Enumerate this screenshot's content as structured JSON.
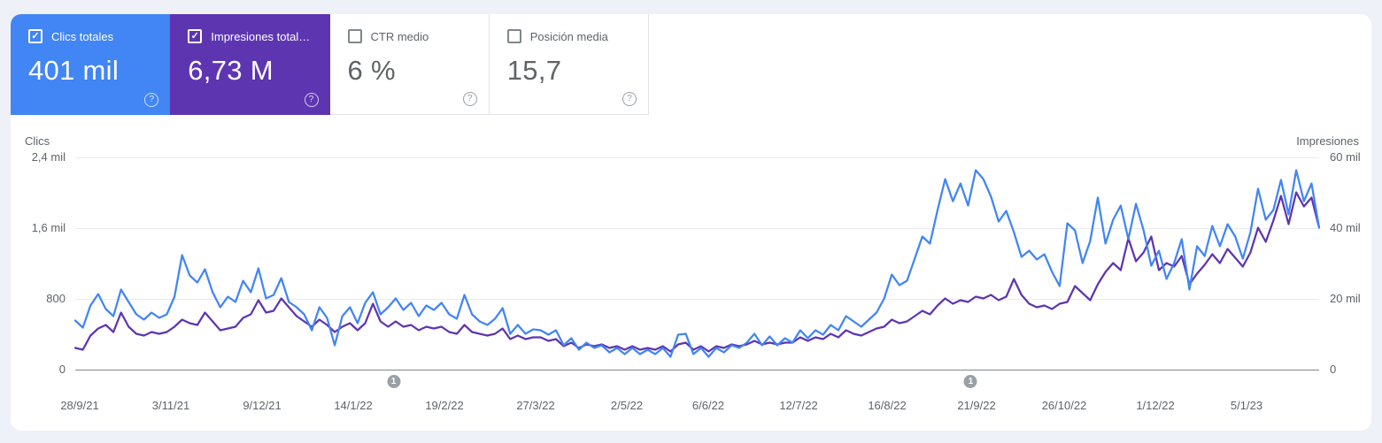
{
  "cards": [
    {
      "label": "Clics totales",
      "value": "401 mil",
      "checked": true,
      "bg": "#4285f4"
    },
    {
      "label": "Impresiones total…",
      "value": "6,73 M",
      "checked": true,
      "bg": "#5e35b1"
    },
    {
      "label": "CTR medio",
      "value": "6 %",
      "checked": false,
      "bg": "#ffffff"
    },
    {
      "label": "Posición media",
      "value": "15,7",
      "checked": false,
      "bg": "#ffffff"
    }
  ],
  "help_glyph": "?",
  "check_glyph": "✓",
  "chart_data": {
    "type": "line",
    "left_axis": {
      "title": "Clics",
      "range": [
        0,
        2400
      ],
      "ticks": [
        "0",
        "800",
        "1,6 mil",
        "2,4 mil"
      ]
    },
    "right_axis": {
      "title": "Impresiones",
      "range": [
        0,
        60
      ],
      "ticks": [
        "0",
        "20 mil",
        "40 mil",
        "60 mil"
      ]
    },
    "x_ticks": [
      "28/9/21",
      "3/11/21",
      "9/12/21",
      "14/1/22",
      "19/2/22",
      "27/3/22",
      "2/5/22",
      "6/6/22",
      "12/7/22",
      "16/8/22",
      "21/9/22",
      "26/10/22",
      "1/12/22",
      "5/1/23"
    ],
    "grid": "horizontal",
    "annotations": [
      {
        "label": "1",
        "x_frac": 0.2559
      },
      {
        "label": "1",
        "x_frac": 0.7199
      }
    ],
    "series": [
      {
        "name": "Impresiones totales",
        "axis": "right",
        "color": "#5e35b1",
        "unit": "mil",
        "values": [
          6.0,
          5.5,
          9.5,
          11.5,
          12.5,
          10.5,
          16.0,
          12.0,
          10.0,
          9.5,
          10.5,
          10.0,
          10.5,
          12.0,
          14.0,
          13.0,
          12.5,
          16.0,
          13.5,
          11.0,
          11.5,
          12.0,
          14.5,
          15.5,
          19.5,
          16.0,
          16.5,
          20.0,
          17.5,
          15.0,
          13.5,
          12.0,
          14.0,
          12.5,
          10.5,
          12.0,
          13.0,
          11.0,
          13.0,
          18.5,
          13.5,
          12.0,
          13.5,
          12.0,
          12.5,
          11.0,
          12.0,
          11.5,
          12.0,
          10.5,
          10.0,
          12.5,
          10.5,
          10.0,
          9.5,
          10.0,
          11.5,
          8.5,
          9.5,
          8.5,
          9.0,
          9.0,
          8.0,
          8.5,
          6.5,
          7.5,
          6.0,
          7.0,
          6.5,
          7.0,
          6.0,
          6.5,
          5.5,
          6.5,
          5.5,
          6.0,
          5.5,
          6.5,
          5.0,
          7.0,
          7.5,
          5.5,
          6.5,
          5.0,
          6.5,
          6.0,
          7.0,
          6.5,
          7.0,
          8.0,
          7.0,
          7.5,
          7.0,
          7.5,
          7.5,
          9.0,
          8.0,
          9.0,
          8.5,
          10.0,
          9.0,
          11.0,
          10.0,
          9.5,
          10.5,
          11.5,
          12.0,
          14.0,
          13.0,
          13.5,
          15.0,
          16.5,
          15.5,
          18.0,
          20.0,
          18.5,
          19.5,
          19.0,
          20.5,
          20.0,
          21.0,
          19.5,
          20.5,
          25.5,
          21.0,
          18.5,
          17.5,
          18.0,
          17.0,
          18.5,
          19.0,
          23.5,
          21.5,
          19.5,
          24.0,
          27.5,
          30.0,
          28.0,
          37.0,
          30.5,
          33.0,
          37.5,
          28.0,
          30.0,
          29.0,
          32.0,
          24.0,
          27.0,
          29.5,
          32.5,
          30.0,
          34.0,
          31.5,
          29.0,
          33.0,
          40.0,
          36.0,
          42.0,
          49.0,
          41.0,
          50.0,
          46.0,
          48.5,
          40.0
        ]
      },
      {
        "name": "Clics totales",
        "axis": "left",
        "color": "#4285f4",
        "unit": "",
        "values": [
          550,
          470,
          720,
          850,
          680,
          600,
          900,
          760,
          620,
          560,
          640,
          580,
          620,
          820,
          1290,
          1060,
          980,
          1130,
          870,
          700,
          820,
          760,
          1000,
          870,
          1140,
          800,
          840,
          1030,
          760,
          700,
          620,
          440,
          700,
          580,
          270,
          600,
          700,
          520,
          750,
          870,
          620,
          700,
          800,
          670,
          750,
          600,
          720,
          670,
          750,
          620,
          570,
          840,
          620,
          540,
          500,
          570,
          690,
          400,
          500,
          400,
          450,
          440,
          390,
          440,
          270,
          350,
          220,
          300,
          240,
          270,
          190,
          240,
          170,
          240,
          170,
          220,
          170,
          240,
          140,
          390,
          400,
          170,
          240,
          140,
          240,
          190,
          270,
          240,
          300,
          400,
          270,
          370,
          270,
          350,
          300,
          440,
          350,
          440,
          390,
          500,
          440,
          600,
          540,
          480,
          560,
          640,
          800,
          1070,
          950,
          1000,
          1250,
          1500,
          1420,
          1800,
          2150,
          1900,
          2100,
          1850,
          2250,
          2150,
          1950,
          1670,
          1790,
          1550,
          1270,
          1340,
          1240,
          1300,
          1100,
          940,
          1650,
          1570,
          1200,
          1450,
          1940,
          1420,
          1690,
          1850,
          1470,
          1870,
          1570,
          1170,
          1340,
          1020,
          1200,
          1470,
          900,
          1390,
          1280,
          1620,
          1390,
          1640,
          1500,
          1250,
          1550,
          2040,
          1690,
          1800,
          2140,
          1750,
          2250,
          1900,
          2100,
          1600
        ]
      }
    ]
  }
}
